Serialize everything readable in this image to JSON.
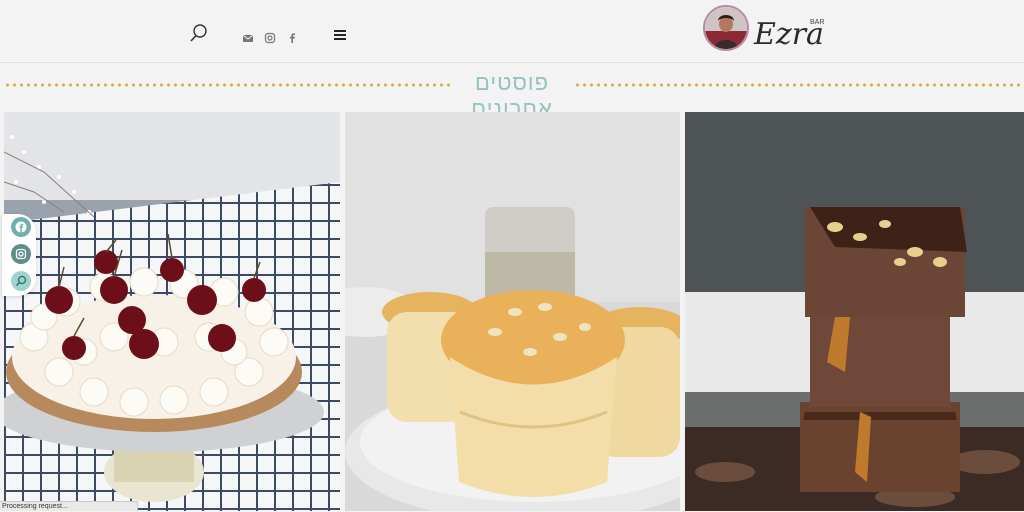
{
  "header": {
    "icons": {
      "search": "search-icon",
      "email": "envelope-icon",
      "instagram": "instagram-icon",
      "facebook": "facebook-icon",
      "menu": "hamburger-menu-icon"
    },
    "logo_text": "Ezra",
    "logo_small_text": "BAR"
  },
  "section": {
    "title": "פוסטים אחרונים",
    "accent_color": "#93c3c2",
    "dots_color": "#d8a93a"
  },
  "posts": [
    {
      "subject": "cherry-cream-tart"
    },
    {
      "subject": "muffins-with-seeds"
    },
    {
      "subject": "stacked-caramel-brownies"
    }
  ],
  "floating_social": {
    "icons": [
      "facebook-icon",
      "instagram-icon",
      "search-icon"
    ],
    "color": "#5fa6a4"
  },
  "status": {
    "text": "Processing request..."
  }
}
